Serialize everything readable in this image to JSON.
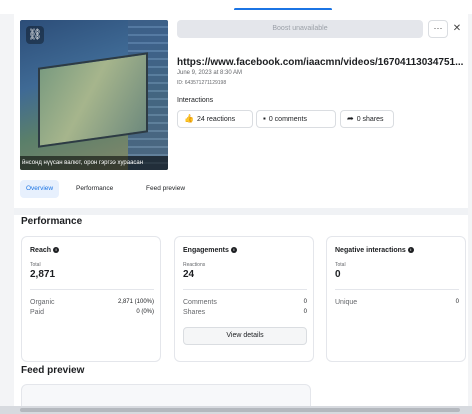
{
  "toolbar": {
    "boost_label": "Boost unavailable",
    "more_label": "···",
    "close_label": "✕"
  },
  "post": {
    "thumbnail_caption": "йнсонд нүүсан валют, орон гэргээ хураасан",
    "link_icon": "⛓",
    "url": "https://www.facebook.com/iaacmn/videos/16704113034751...",
    "date": "June 9, 2023 at 8:30 AM",
    "id": "ID: 643571271129198",
    "interactions_label": "Interactions",
    "reactions": "24 reactions",
    "comments": "0 comments",
    "shares": "0 shares"
  },
  "tabs": {
    "overview": "Overview",
    "performance": "Performance",
    "feed_preview": "Feed preview"
  },
  "performance": {
    "title": "Performance",
    "reach": {
      "title": "Reach",
      "total_label": "Total",
      "total_value": "2,871",
      "organic_label": "Organic",
      "organic_value": "2,871 (100%)",
      "paid_label": "Paid",
      "paid_value": "0 (0%)"
    },
    "engagements": {
      "title": "Engagements",
      "reactions_label": "Reactions",
      "reactions_value": "24",
      "comments_label": "Comments",
      "comments_value": "0",
      "shares_label": "Shares",
      "shares_value": "0",
      "view_details": "View details"
    },
    "negative": {
      "title": "Negative interactions",
      "total_label": "Total",
      "total_value": "0",
      "unique_label": "Unique",
      "unique_value": "0"
    }
  },
  "feed_preview": {
    "title": "Feed preview"
  },
  "colors": {
    "accent": "#1b74e4",
    "overview_tab_bg": "#e7f0fd"
  }
}
